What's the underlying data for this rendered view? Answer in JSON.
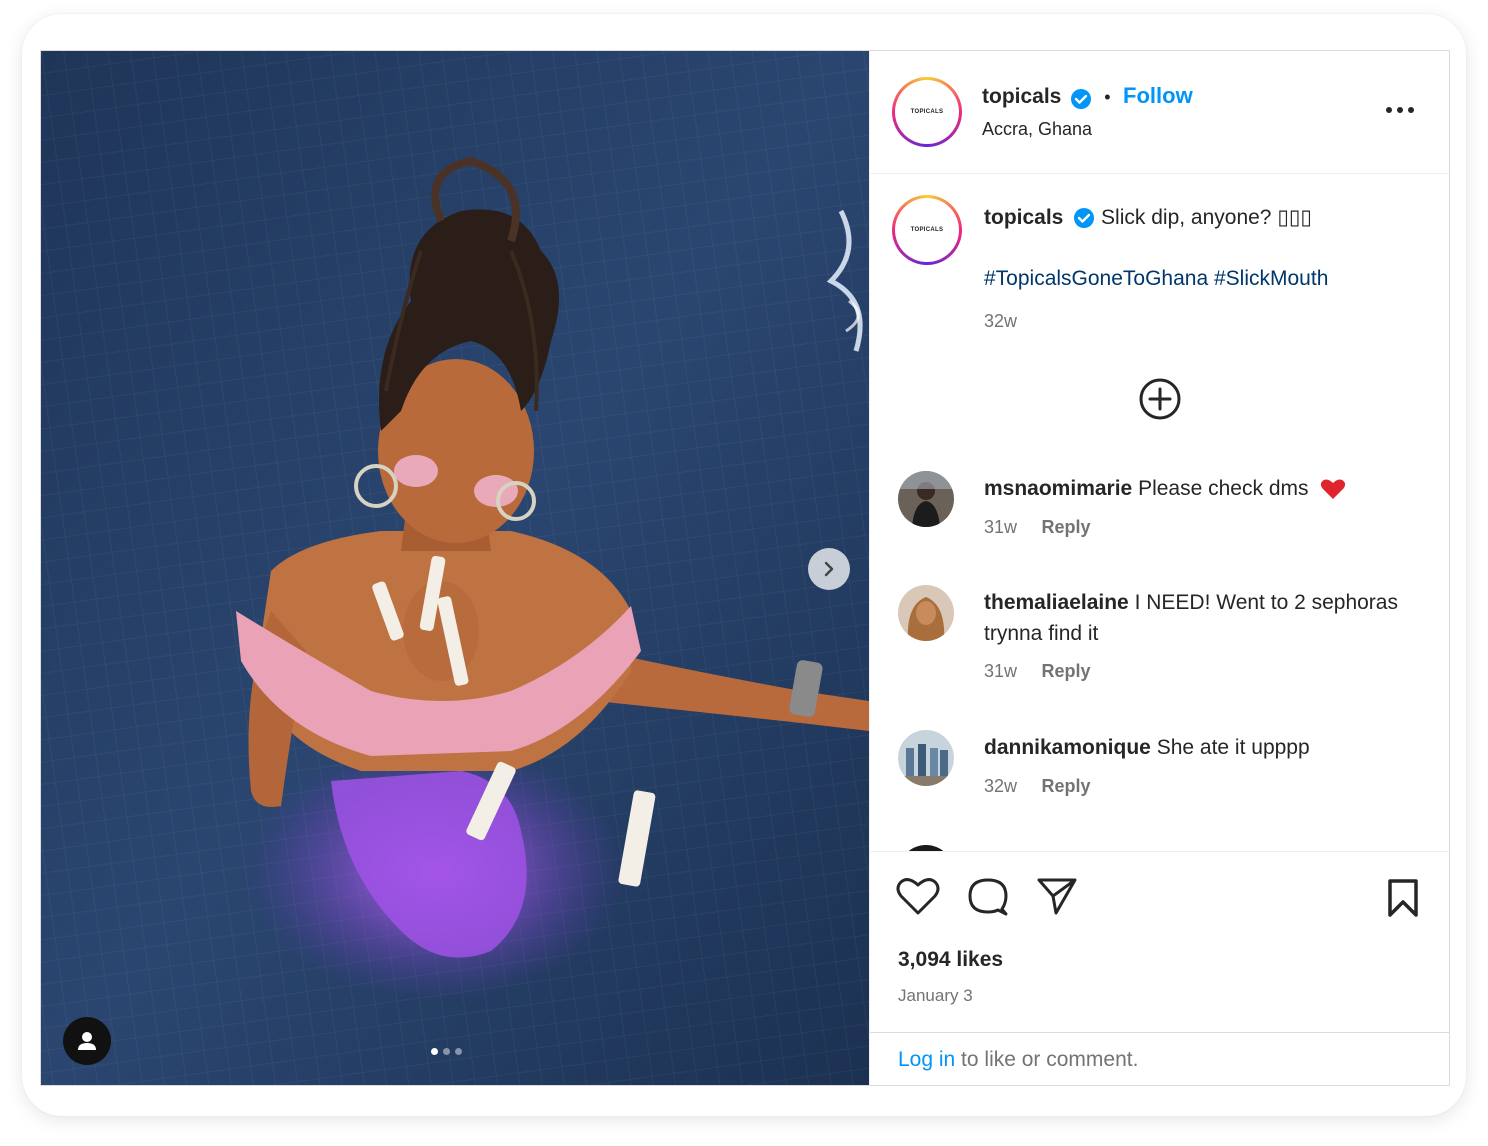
{
  "post": {
    "media": {
      "slide_index": 1,
      "slide_count": 3
    },
    "header": {
      "avatar_text": "TOPICALS",
      "username": "topicals",
      "separator": "•",
      "follow_label": "Follow",
      "location": "Accra, Ghana",
      "verified_color": "#0095f6"
    },
    "caption": {
      "username": "topicals",
      "text": "Slick dip, anyone? ▯▯▯",
      "hashtags": "#TopicalsGoneToGhana #SlickMouth",
      "time": "32w"
    },
    "comments": [
      {
        "username": "msnaomimarie",
        "text": "Please check dms",
        "emoji": "❤️",
        "time": "31w",
        "reply_label": "Reply"
      },
      {
        "username": "themaliaelaine",
        "text": "I NEED! Went to 2 sephoras trynna find it",
        "time": "31w",
        "reply_label": "Reply"
      },
      {
        "username": "dannikamonique",
        "text": "She ate it upppp",
        "time": "32w",
        "reply_label": "Reply"
      }
    ],
    "likes": "3,094 likes",
    "date": "January 3",
    "login": {
      "link_label": "Log in",
      "rest": " to like or comment."
    }
  }
}
